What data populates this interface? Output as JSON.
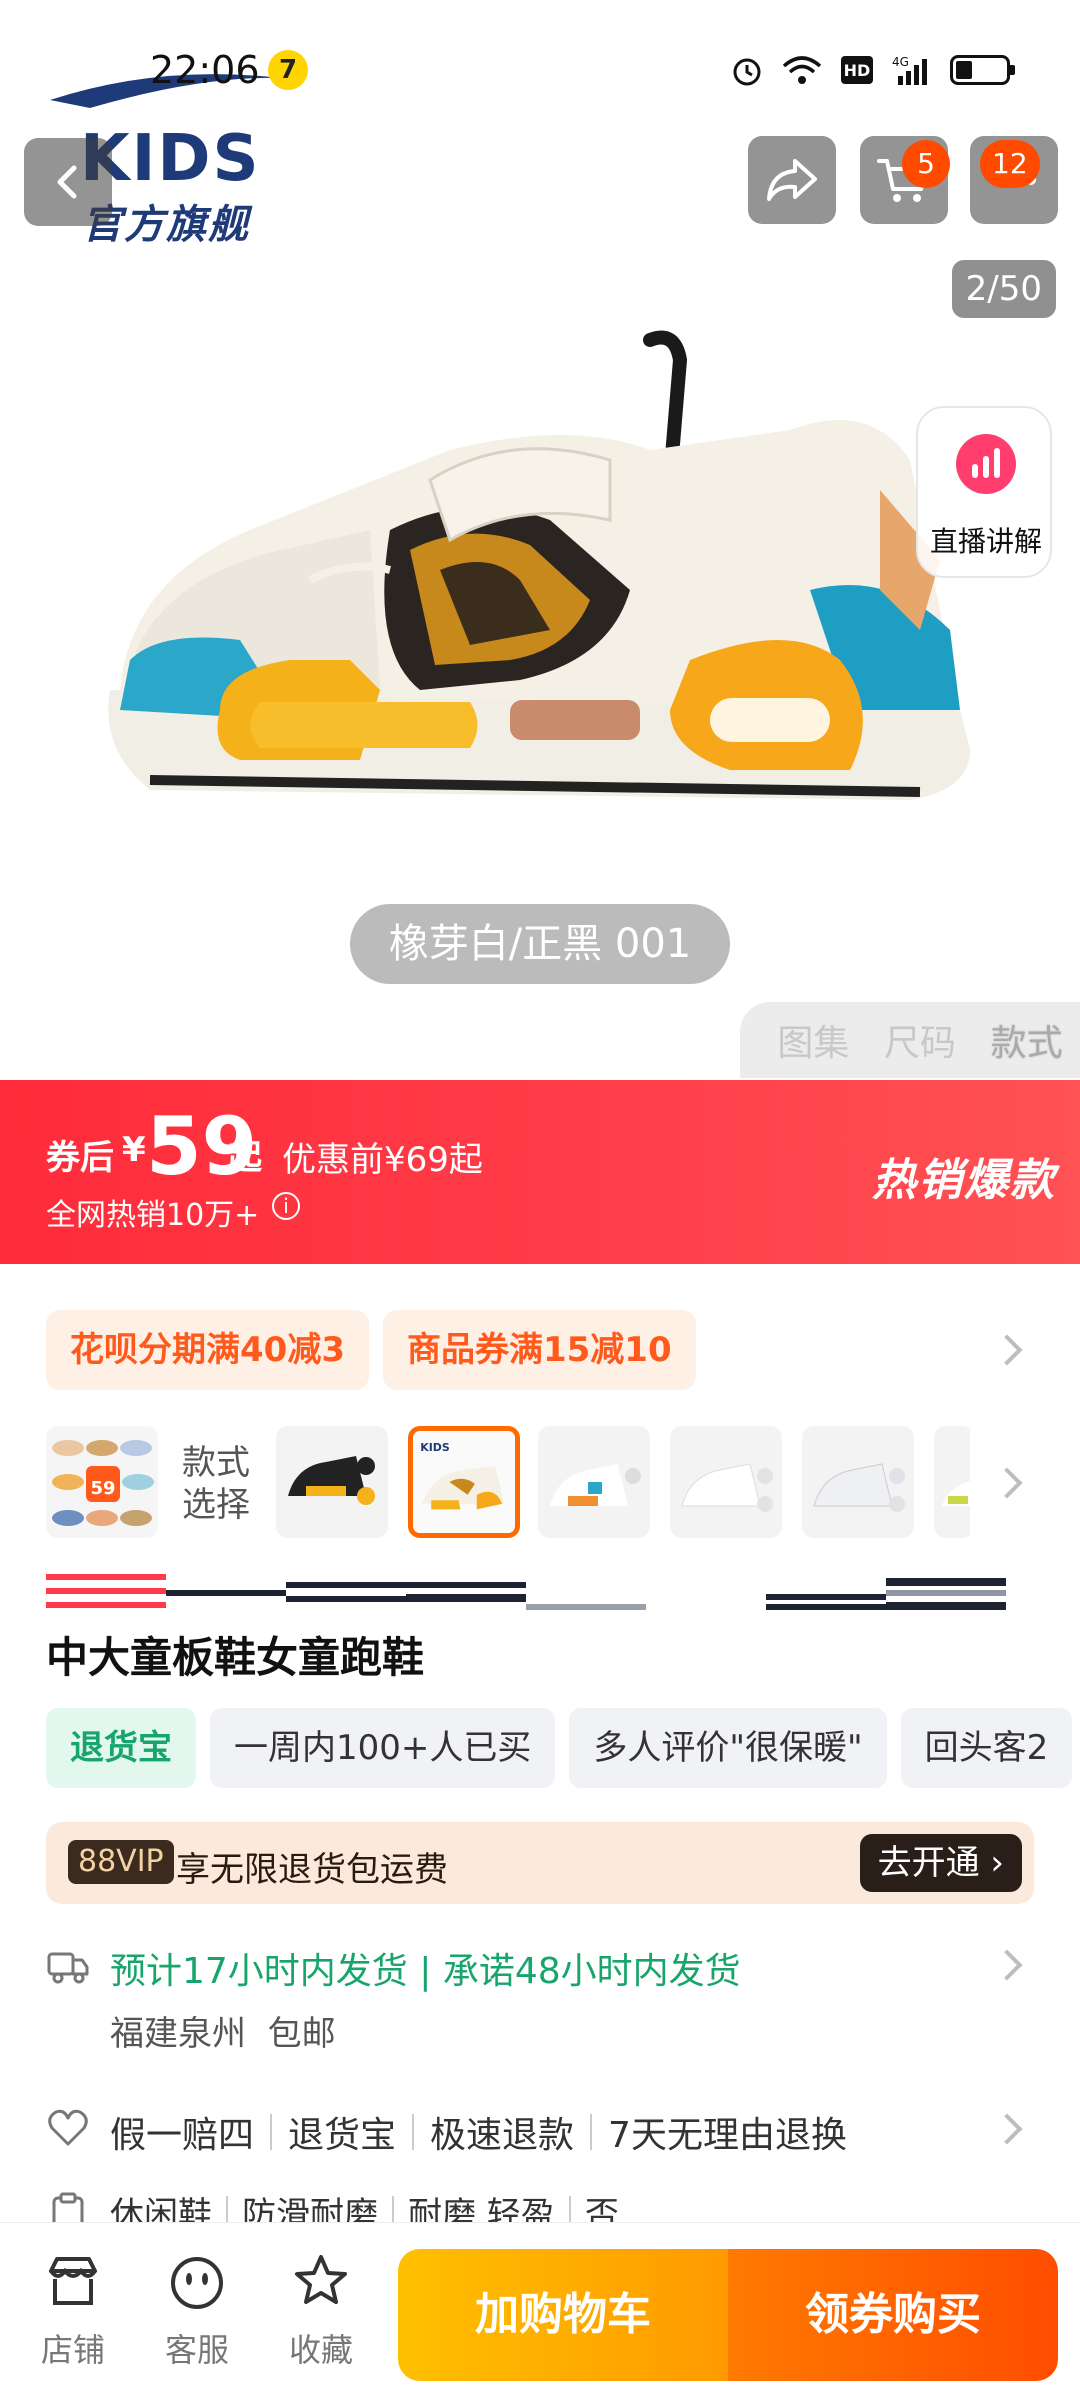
{
  "status_bar": {
    "time": "22:06",
    "notification_badge": "7",
    "network": "4G"
  },
  "brand": {
    "kids_text": "KIDS",
    "store_text": "官方旗舰"
  },
  "header": {
    "cart_count": "5",
    "more_count": "12"
  },
  "gallery": {
    "counter": "2/50",
    "live_label": "直播讲解",
    "color_name": "橡芽白/正黑 001",
    "tabs": [
      {
        "label": "图集",
        "active": false
      },
      {
        "label": "尺码",
        "active": false
      },
      {
        "label": "款式",
        "active": true
      }
    ]
  },
  "price_banner": {
    "after_label": "券后",
    "currency": "¥",
    "price": "59",
    "from_label": "起",
    "before_label": "优惠前¥69起",
    "sales_text": "全网热销10万+",
    "hot_label": "热销爆款"
  },
  "coupons": [
    "花呗分期满40减3",
    "商品券满15减10"
  ],
  "styles": {
    "label": "款式选择",
    "thumb_count": 7,
    "selected_index": 2,
    "promo_thumb_price": "59"
  },
  "product": {
    "title": "中大童板鞋女童跑鞋"
  },
  "tags": [
    {
      "label": "退货宝",
      "highlight": true
    },
    {
      "label": "一周内100+人已买",
      "highlight": false
    },
    {
      "label": "多人评价\"很保暖\"",
      "highlight": false
    },
    {
      "label": "回头客2",
      "highlight": false
    }
  ],
  "vip": {
    "badge": "88VIP",
    "text": "享无限退货包运费",
    "button": "去开通"
  },
  "shipping": {
    "line1": "预计17小时内发货 | 承诺48小时内发货",
    "origin": "福建泉州",
    "free_shipping": "包邮"
  },
  "guarantees": [
    "假一赔四",
    "退货宝",
    "极速退款",
    "7天无理由退换"
  ],
  "attributes": [
    "休闲鞋",
    "防滑耐磨",
    "耐磨 轻盈",
    "否"
  ],
  "bottom_bar": {
    "shop_label": "店铺",
    "service_label": "客服",
    "favorite_label": "收藏",
    "add_cart_label": "加购物车",
    "buy_label": "领券购买"
  },
  "colors": {
    "accent_orange": "#ff5a1c",
    "banner_red": "#ff2b3a",
    "green": "#17a56b",
    "brand_navy": "#1f3a78"
  }
}
